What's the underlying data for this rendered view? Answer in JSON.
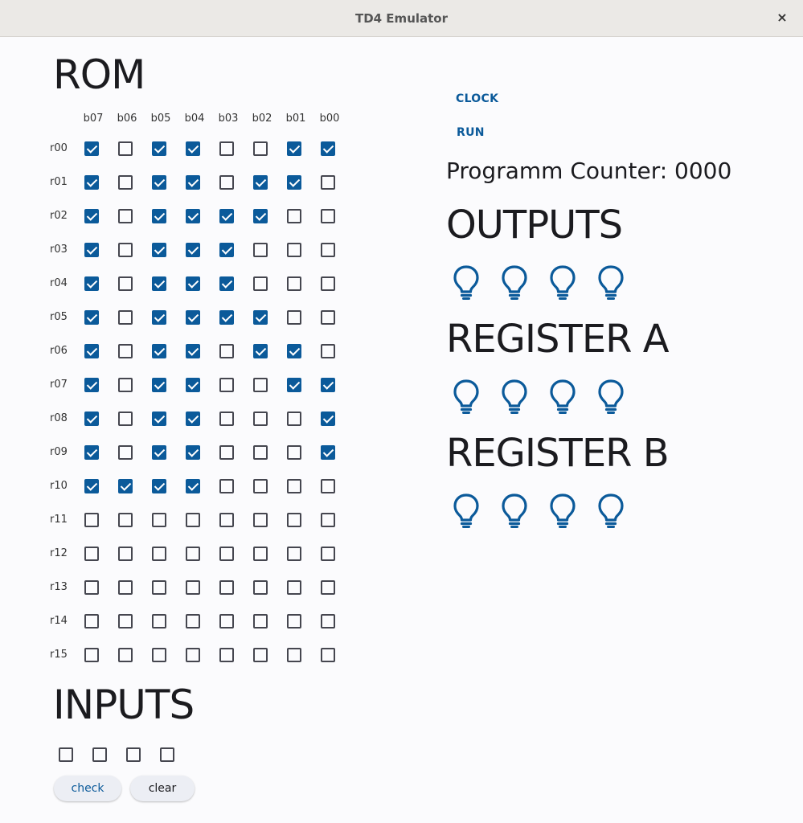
{
  "window": {
    "title": "TD4 Emulator",
    "close_glyph": "×"
  },
  "rom": {
    "title": "ROM",
    "columns": [
      "b07",
      "b06",
      "b05",
      "b04",
      "b03",
      "b02",
      "b01",
      "b00"
    ],
    "rows": [
      {
        "label": "r00",
        "bits": [
          1,
          0,
          1,
          1,
          0,
          0,
          1,
          1
        ]
      },
      {
        "label": "r01",
        "bits": [
          1,
          0,
          1,
          1,
          0,
          1,
          1,
          0
        ]
      },
      {
        "label": "r02",
        "bits": [
          1,
          0,
          1,
          1,
          1,
          1,
          0,
          0
        ]
      },
      {
        "label": "r03",
        "bits": [
          1,
          0,
          1,
          1,
          1,
          0,
          0,
          0
        ]
      },
      {
        "label": "r04",
        "bits": [
          1,
          0,
          1,
          1,
          1,
          0,
          0,
          0
        ]
      },
      {
        "label": "r05",
        "bits": [
          1,
          0,
          1,
          1,
          1,
          1,
          0,
          0
        ]
      },
      {
        "label": "r06",
        "bits": [
          1,
          0,
          1,
          1,
          0,
          1,
          1,
          0
        ]
      },
      {
        "label": "r07",
        "bits": [
          1,
          0,
          1,
          1,
          0,
          0,
          1,
          1
        ]
      },
      {
        "label": "r08",
        "bits": [
          1,
          0,
          1,
          1,
          0,
          0,
          0,
          1
        ]
      },
      {
        "label": "r09",
        "bits": [
          1,
          0,
          1,
          1,
          0,
          0,
          0,
          1
        ]
      },
      {
        "label": "r10",
        "bits": [
          1,
          1,
          1,
          1,
          0,
          0,
          0,
          0
        ]
      },
      {
        "label": "r11",
        "bits": [
          0,
          0,
          0,
          0,
          0,
          0,
          0,
          0
        ]
      },
      {
        "label": "r12",
        "bits": [
          0,
          0,
          0,
          0,
          0,
          0,
          0,
          0
        ]
      },
      {
        "label": "r13",
        "bits": [
          0,
          0,
          0,
          0,
          0,
          0,
          0,
          0
        ]
      },
      {
        "label": "r14",
        "bits": [
          0,
          0,
          0,
          0,
          0,
          0,
          0,
          0
        ]
      },
      {
        "label": "r15",
        "bits": [
          0,
          0,
          0,
          0,
          0,
          0,
          0,
          0
        ]
      }
    ]
  },
  "inputs": {
    "title": "INPUTS",
    "bits": [
      0,
      0,
      0,
      0
    ],
    "check_label": "check",
    "clear_label": "clear"
  },
  "controls": {
    "clock_label": "CLOCK",
    "run_label": "RUN"
  },
  "program_counter": {
    "text": "Programm Counter: 0000"
  },
  "outputs": {
    "title": "OUTPUTS",
    "lamps": [
      0,
      0,
      0,
      0
    ]
  },
  "register_a": {
    "title": "REGISTER A",
    "lamps": [
      0,
      0,
      0,
      0
    ]
  },
  "register_b": {
    "title": "REGISTER B",
    "lamps": [
      0,
      0,
      0,
      0
    ]
  },
  "colors": {
    "accent": "#0b5a9a",
    "titlebar": "#ebe9e6",
    "background": "#fbfbfd"
  },
  "icons": {
    "lamp": "lightbulb-outline-icon",
    "close": "close-icon"
  }
}
